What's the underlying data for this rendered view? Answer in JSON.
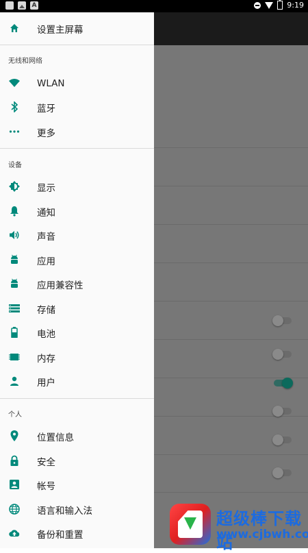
{
  "status_bar": {
    "time": "9:19",
    "notif_letter": "A"
  },
  "drawer": {
    "home": {
      "label": "设置主屏幕",
      "icon": "home-icon"
    },
    "sections": {
      "wireless": "无线和网络",
      "device": "设备",
      "personal": "个人"
    },
    "items": {
      "wlan": "WLAN",
      "bluetooth": "蓝牙",
      "more": "更多",
      "display": "显示",
      "notifications": "通知",
      "sound": "声音",
      "apps": "应用",
      "app_compat": "应用兼容性",
      "storage": "存储",
      "battery": "电池",
      "memory": "内存",
      "users": "用户",
      "location": "位置信息",
      "security": "安全",
      "accounts": "帐号",
      "language": "语言和输入法",
      "backup": "备份和重置"
    }
  },
  "background": {
    "switches": [
      false,
      false,
      true,
      false,
      false,
      false
    ]
  },
  "watermark": {
    "title": "超级棒下载站",
    "url": "www.cjbwh.com"
  },
  "colors": {
    "accent": "#00897b",
    "scrim": "#777777"
  }
}
